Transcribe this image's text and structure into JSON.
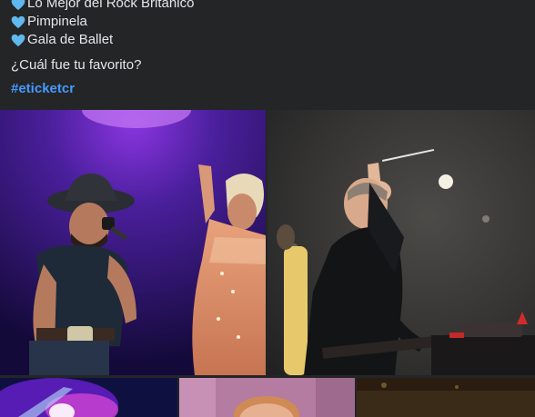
{
  "post": {
    "list_items": [
      {
        "icon": "blue-heart-icon",
        "text": "Lo Mejor del Rock Británico"
      },
      {
        "icon": "blue-heart-icon",
        "text": "Pimpinela"
      },
      {
        "icon": "blue-heart-icon",
        "text": "Gala de Ballet"
      }
    ],
    "question": "¿Cuál fue tu favorito?",
    "hashtag": "#eticketcr"
  },
  "colors": {
    "background": "#242526",
    "text": "#e4e6eb",
    "hashtag": "#4599ff",
    "heart": "#5fb8ee"
  }
}
